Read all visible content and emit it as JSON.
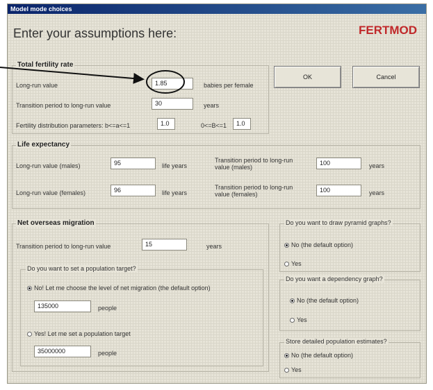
{
  "window": {
    "title": "Model mode choices"
  },
  "header": {
    "heading": "Enter your assumptions here:",
    "brand": "FERTMOD"
  },
  "buttons": {
    "ok": "OK",
    "cancel": "Cancel"
  },
  "fertility": {
    "title": "Total fertility rate",
    "long_run_label": "Long-run value",
    "long_run_value": "1.85",
    "long_run_unit": "babies per female",
    "transition_label": "Transition period to long-run value",
    "transition_value": "30",
    "transition_unit": "years",
    "dist_label": "Fertility distribution parameters: b<=a<=1",
    "dist_value_a": "1.0",
    "dist_label_b": "0<=B<=1",
    "dist_value_b": "1.0"
  },
  "life": {
    "title": "Life expectancy",
    "male_label": "Long-run value (males)",
    "male_value": "95",
    "male_unit": "life years",
    "female_label": "Long-run value (females)",
    "female_value": "96",
    "female_unit": "life years",
    "male_trans_label": "Transition period to long-run value (males)",
    "male_trans_value": "100",
    "male_trans_unit": "years",
    "female_trans_label": "Transition period to long-run value (females)",
    "female_trans_value": "100",
    "female_trans_unit": "years"
  },
  "migration": {
    "title": "Net overseas migration",
    "transition_label": "Transition period to long-run value",
    "transition_value": "15",
    "transition_unit": "years",
    "target_question": "Do you want to set a population target?",
    "option_no": "No! Let me choose the level of net migration (the default option)",
    "net_value": "135000",
    "net_unit": "people",
    "option_yes": "Yes! Let me set a population target",
    "target_value": "35000000",
    "target_unit": "people"
  },
  "pyramid": {
    "question": "Do you want to draw pyramid graphs?",
    "option_no": "No (the default option)",
    "option_yes": "Yes"
  },
  "dependency": {
    "question": "Do you want a dependency graph?",
    "option_no": "No (the default option)",
    "option_yes": "Yes"
  },
  "store": {
    "question": "Store detailed population estimates?",
    "option_no": "No (the default option)",
    "option_yes": "Yes"
  }
}
